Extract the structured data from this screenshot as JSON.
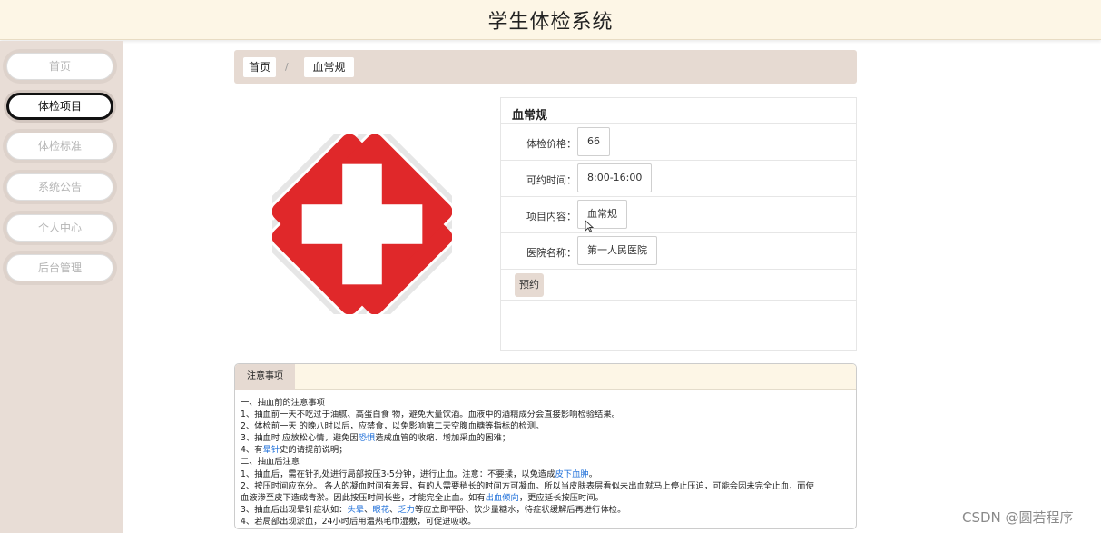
{
  "header": {
    "title": "学生体检系统"
  },
  "sidebar": {
    "items": [
      {
        "label": "首页",
        "active": false
      },
      {
        "label": "体检项目",
        "active": true
      },
      {
        "label": "体检标准",
        "active": false
      },
      {
        "label": "系统公告",
        "active": false
      },
      {
        "label": "个人中心",
        "active": false
      },
      {
        "label": "后台管理",
        "active": false
      }
    ]
  },
  "breadcrumb": {
    "home": "首页",
    "separator": "/",
    "current": "血常规"
  },
  "logo": {
    "icon": "red-cross-icon",
    "colors": {
      "red": "#e0282a",
      "white": "#ffffff"
    }
  },
  "detail": {
    "title": "血常规",
    "fields": [
      {
        "label": "体检价格：",
        "value": "66"
      },
      {
        "label": "可约时间：",
        "value": "8:00-16:00"
      },
      {
        "label": "项目内容：",
        "value": "血常规"
      },
      {
        "label": "医院名称：",
        "value": "第一人民医院"
      }
    ],
    "book_label": "预约"
  },
  "notice": {
    "tab_label": "注意事项",
    "lines": [
      {
        "parts": [
          {
            "t": "一、抽血前的注意事项"
          }
        ]
      },
      {
        "parts": [
          {
            "t": "1、抽血前一天不吃过于油腻、高蛋白食 物，避免大量饮酒。血液中的酒精成分会直接影响检验结果。"
          }
        ]
      },
      {
        "parts": [
          {
            "t": "2、体检前一天 的晚八时以后，应禁食，以免影响第二天空腹血糖等指标的检测。"
          }
        ]
      },
      {
        "parts": [
          {
            "t": "3、抽血时 应放松心情，避免因"
          },
          {
            "t": "恐惧",
            "hl": true
          },
          {
            "t": "造成血管的收缩、增加采血的困难；"
          }
        ]
      },
      {
        "parts": [
          {
            "t": "4、有"
          },
          {
            "t": "晕针",
            "hl": true
          },
          {
            "t": "史的请提前说明；"
          }
        ]
      },
      {
        "parts": [
          {
            "t": "二、抽血后注意"
          }
        ]
      },
      {
        "parts": [
          {
            "t": "1、抽血后，需在针孔处进行局部按压3-5分钟，进行止血。注意：不要揉，以免造成"
          },
          {
            "t": "皮下血肿",
            "hl": true
          },
          {
            "t": "。"
          }
        ]
      },
      {
        "parts": [
          {
            "t": "2、按压时间应充分。 各人的凝血时间有差异，有的人需要稍长的时间方可凝血。所以当皮肤表层看似未出血就马上停止压迫，可能会因未完全止血，而使"
          }
        ]
      },
      {
        "parts": [
          {
            "t": "血液渗至皮下造成青淤。因此按压时间长些，才能完全止血。如有"
          },
          {
            "t": "出血倾向",
            "hl": true
          },
          {
            "t": "，更应延长按压时间。"
          }
        ]
      },
      {
        "parts": [
          {
            "t": "3、抽血后出现晕针症状如："
          },
          {
            "t": "头晕",
            "hl": true
          },
          {
            "t": "、"
          },
          {
            "t": "眼花",
            "hl": true
          },
          {
            "t": "、"
          },
          {
            "t": "乏力",
            "hl": true
          },
          {
            "t": "等应立即平卧、饮少量糖水，待症状缓解后再进行体检。"
          }
        ]
      },
      {
        "parts": [
          {
            "t": "4、若局部出现淤血，24小时后用温热毛巾湿敷，可促进吸收。"
          }
        ]
      }
    ]
  },
  "watermark": "CSDN @圆若程序",
  "colors": {
    "header_bg": "#fdf6e6",
    "sidebar_bg": "#e8ddd6",
    "accent_bg": "#e6dad2",
    "link": "#1e6fd9"
  }
}
